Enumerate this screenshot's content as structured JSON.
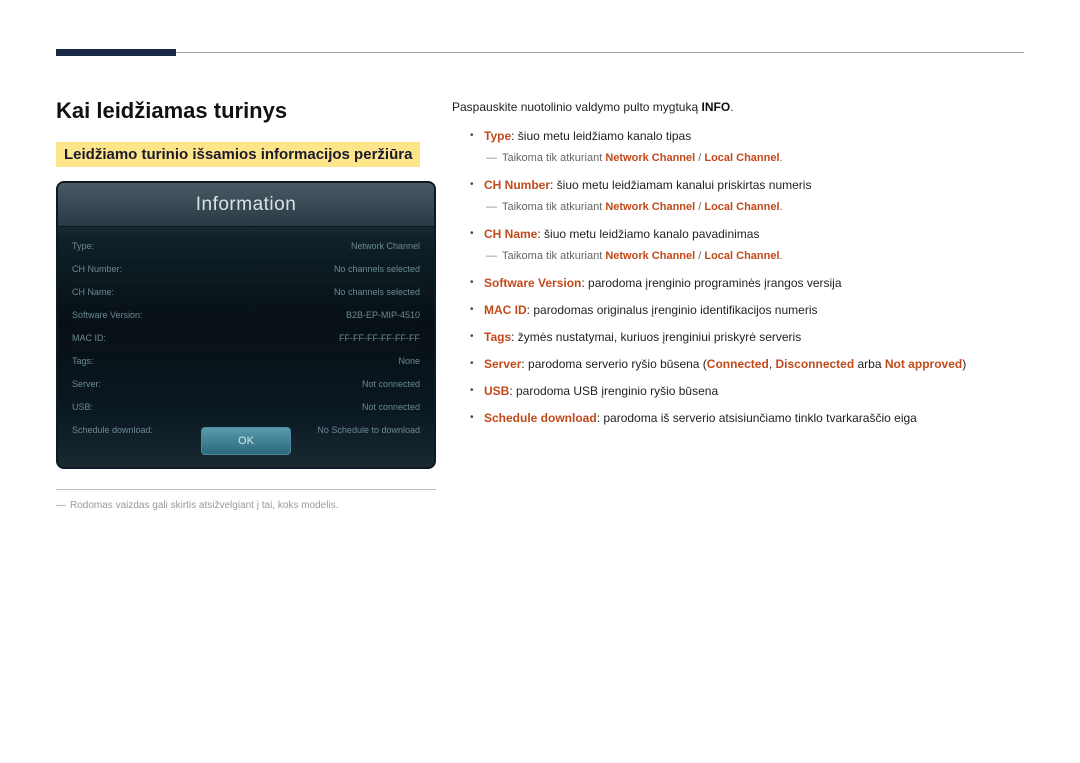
{
  "title": "Kai leidžiamas turinys",
  "subheading": "Leidžiamo turinio išsamios informacijos peržiūra",
  "panel": {
    "header": "Information",
    "rows": [
      {
        "label": "Type:",
        "value": "Network Channel"
      },
      {
        "label": "CH Number:",
        "value": "No channels selected"
      },
      {
        "label": "CH Name:",
        "value": "No channels selected"
      },
      {
        "label": "Software Version:",
        "value": "B2B-EP-MIP-4510"
      },
      {
        "label": "MAC ID:",
        "value": "FF-FF-FF-FF-FF-FF"
      },
      {
        "label": "Tags:",
        "value": "None"
      },
      {
        "label": "Server:",
        "value": "Not connected"
      },
      {
        "label": "USB:",
        "value": "Not connected"
      },
      {
        "label": "Schedule download:",
        "value": "No Schedule to download"
      }
    ],
    "ok": "OK"
  },
  "footnote": "Rodomas vaizdas gali skirtis atsižvelgiant į tai, koks modelis.",
  "intro": {
    "pre": "Paspauskite nuotolinio valdymo pulto mygtuką ",
    "bold": "INFO",
    "post": "."
  },
  "note_prefix": "Taikoma tik atkuriant ",
  "note_nc": "Network Channel",
  "note_sep": " / ",
  "note_lc": "Local Channel",
  "note_suffix": ".",
  "items": {
    "type": {
      "head": "Type",
      "text": ": šiuo metu leidžiamo kanalo tipas"
    },
    "chnum": {
      "head": "CH Number",
      "text": ": šiuo metu leidžiamam kanalui priskirtas numeris"
    },
    "chname": {
      "head": "CH Name",
      "text": ": šiuo metu leidžiamo kanalo pavadinimas"
    },
    "sw": {
      "head": "Software Version",
      "text": ": parodoma įrenginio programinės įrangos versija"
    },
    "mac": {
      "head": "MAC ID",
      "text": ": parodomas originalus įrenginio identifikacijos numeris"
    },
    "tags": {
      "head": "Tags",
      "text": ": žymės nustatymai, kuriuos įrenginiui priskyrė serveris"
    },
    "server": {
      "head": "Server",
      "pre": ": parodoma serverio ryšio būsena (",
      "s1": "Connected",
      "sep1": ", ",
      "s2": "Disconnected",
      "sep2": " arba ",
      "s3": "Not approved",
      "post": ")"
    },
    "usb": {
      "head": "USB",
      "text": ": parodoma USB įrenginio ryšio būsena"
    },
    "sched": {
      "head": "Schedule download",
      "text": ": parodoma iš serverio atsisiunčiamo tinklo tvarkaraščio eiga"
    }
  }
}
